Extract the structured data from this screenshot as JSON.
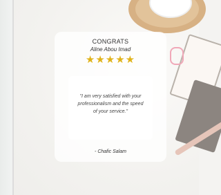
{
  "card": {
    "title": "CONGRATS",
    "name": "Aline Abou Imad",
    "rating": 5,
    "stars_text": "★★★★★",
    "quote": "\"I am very satisfied with your professionalism and the speed of your service.\"",
    "author": "- Chafic Salam"
  },
  "colors": {
    "star": "#e0b319",
    "background": "#f4f3f1",
    "card": "#ffffff"
  }
}
